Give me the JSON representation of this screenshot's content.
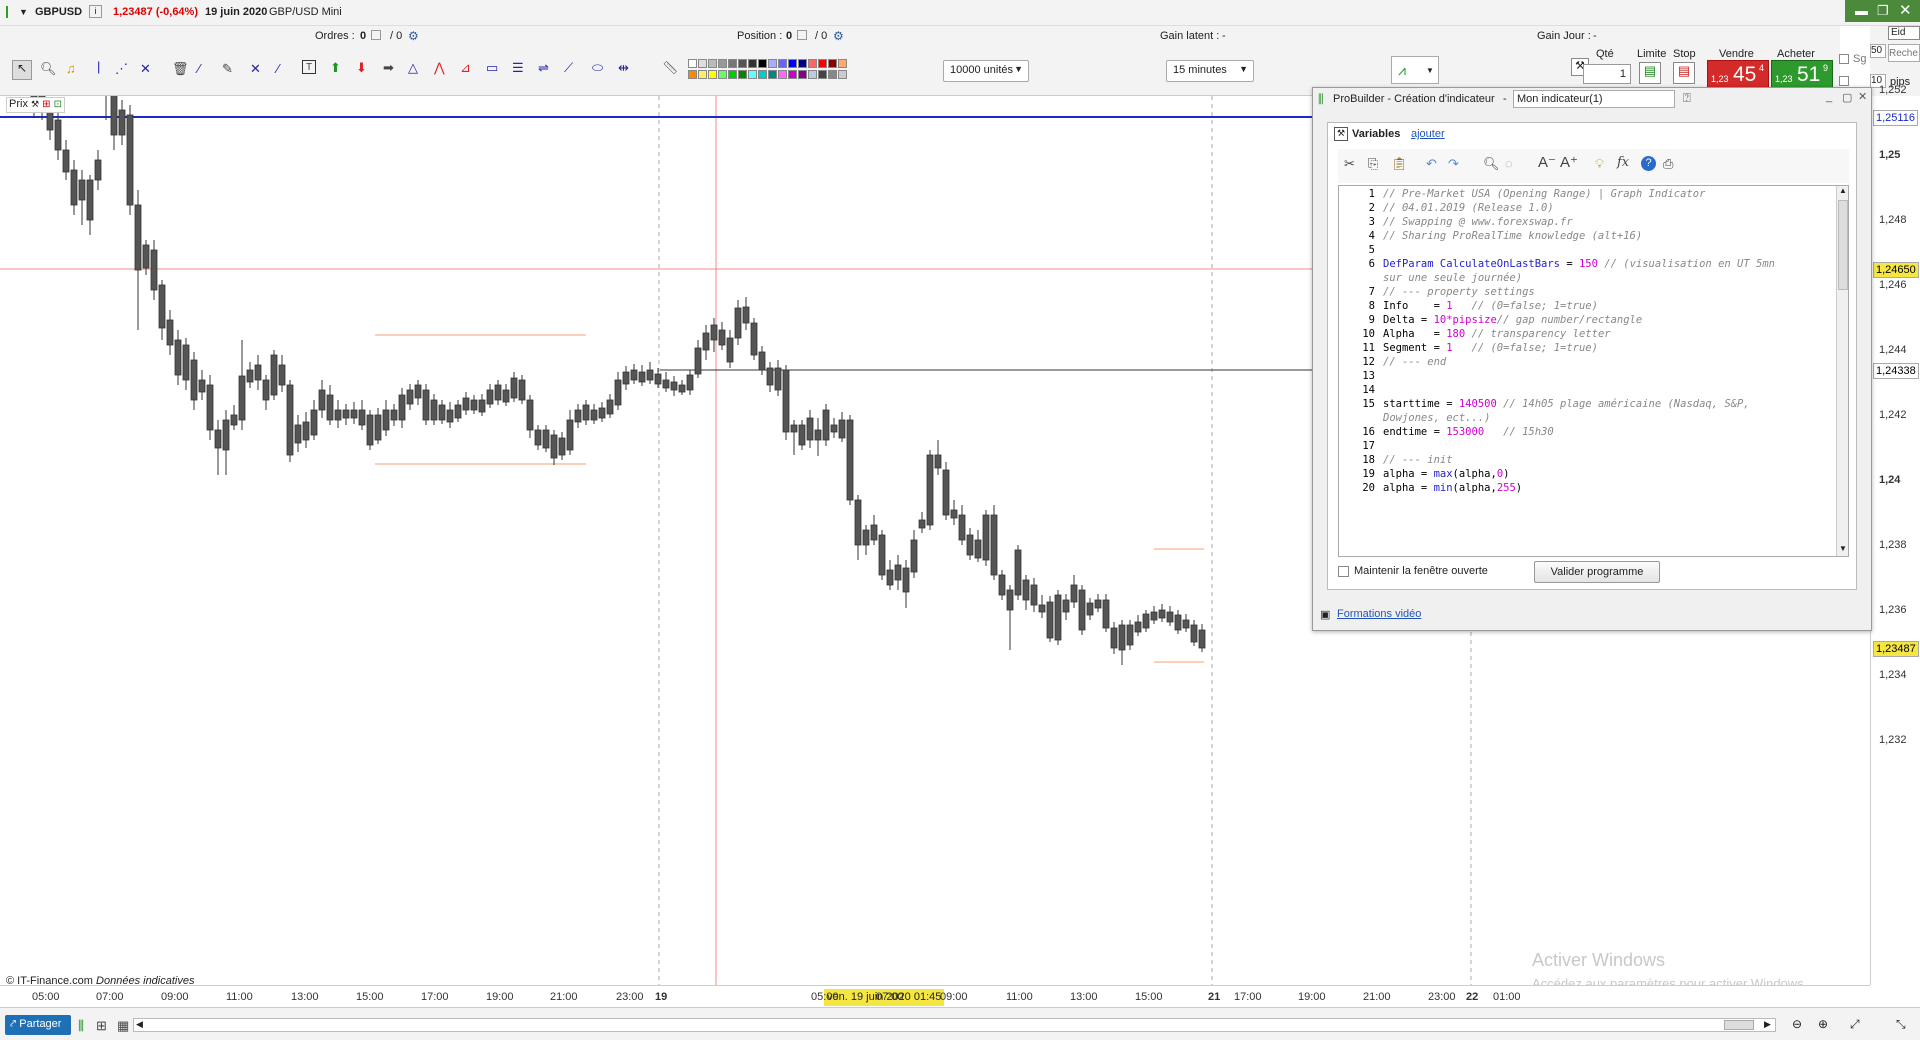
{
  "header": {
    "symbol": "GBPUSD",
    "price": "1,23487 (-0,64%)",
    "date": "19 juin 2020",
    "instrument": "GBP/USD Mini"
  },
  "stats": {
    "orders_label": "Ordres :",
    "orders_value": "0",
    "orders_sep": "/ 0",
    "position_label": "Position :",
    "position_value": "0",
    "position_sep": "/ 0",
    "latent_label": "Gain latent :",
    "latent_value": "-",
    "day_label": "Gain Jour :",
    "day_value": "-"
  },
  "toolbar": {
    "units": "10000 unités",
    "timeframe": "15 minutes"
  },
  "trade": {
    "qty_label": "Qté",
    "qty_value": "1",
    "limit_label": "Limite",
    "stop_label": "Stop",
    "sell_label": "Vendre",
    "buy_label": "Acheter",
    "sell_small": "1,23",
    "sell_big": "45",
    "sell_sup": "4",
    "buy_small": "1,23",
    "buy_big": "51",
    "buy_sup": "9",
    "sg_label": "Sg",
    "sg_value": "50",
    "pips_value": "10",
    "pips_label": "pips",
    "search_placeholder": "Reche",
    "right_tab": "Eid"
  },
  "chart": {
    "prix_label": "Prix",
    "source": "© IT-Finance.com",
    "source_note": "Données indicatives",
    "watermark1": "Activer Windows",
    "watermark2": "Accédez aux paramètres pour activer Windows.",
    "crosshair_date": "ven. 19 juin 2020 01:45"
  },
  "price_axis": {
    "labels": [
      "1,252",
      "1,25",
      "1,248",
      "1,246",
      "1,244",
      "1,242",
      "1,24",
      "1,238",
      "1,236",
      "1,234",
      "1,232"
    ],
    "tags": [
      "1,25116",
      "1,24650",
      "1,24338",
      "1,23487"
    ]
  },
  "time_axis": {
    "labels": [
      "05:00",
      "07:00",
      "09:00",
      "11:00",
      "13:00",
      "15:00",
      "17:00",
      "19:00",
      "21:00",
      "23:00",
      "19",
      "05:00",
      "07:00",
      "09:00",
      "11:00",
      "13:00",
      "15:00",
      "21",
      "17:00",
      "19:00",
      "21:00",
      "23:00",
      "22",
      "01:00"
    ]
  },
  "bottom": {
    "share": "Partager"
  },
  "probuilder": {
    "title": "ProBuilder - Création d'indicateur",
    "name": "Mon indicateur(1)",
    "variables": "Variables",
    "add": "ajouter",
    "keep_open": "Maintenir la fenêtre ouverte",
    "validate": "Valider programme",
    "video": "Formations vidéo",
    "lines": [
      "1",
      "2",
      "3",
      "4",
      "5",
      "6",
      "",
      "7",
      "8",
      "9",
      "10",
      "11",
      "12",
      "13",
      "14",
      "15",
      "",
      "16",
      "17",
      "18",
      "19",
      "20"
    ]
  }
}
